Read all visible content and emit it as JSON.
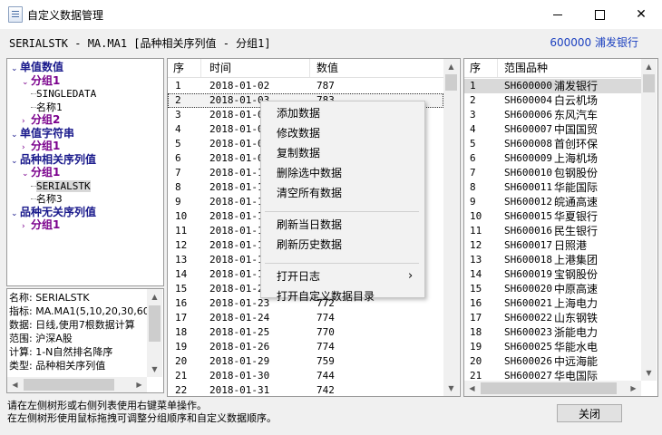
{
  "window": {
    "title": "自定义数据管理",
    "minimize": "—",
    "maximize": "☐",
    "close": "✕"
  },
  "infobar": {
    "serial_label": "SERIALSTK - MA.MA1 [品种相关序列值 - 分组1]",
    "stock": "600000 浦发银行",
    "stock_color": "#1a3fbf"
  },
  "tree": [
    {
      "label": "单值数值",
      "level": 0,
      "style": "blue",
      "expanded": true
    },
    {
      "label": "分组1",
      "level": 1,
      "style": "purple",
      "expanded": true
    },
    {
      "label": "SINGLEDATA",
      "level": 2,
      "style": "leaf"
    },
    {
      "label": "名称1",
      "level": 2,
      "style": "leaf"
    },
    {
      "label": "分组2",
      "level": 1,
      "style": "purple",
      "expanded": false
    },
    {
      "label": "单值字符串",
      "level": 0,
      "style": "blue",
      "expanded": true
    },
    {
      "label": "分组1",
      "level": 1,
      "style": "purple",
      "expanded": false
    },
    {
      "label": "品种相关序列值",
      "level": 0,
      "style": "blue",
      "expanded": true
    },
    {
      "label": "分组1",
      "level": 1,
      "style": "purple",
      "expanded": true
    },
    {
      "label": "SERIALSTK",
      "level": 2,
      "style": "leaf",
      "selected": true
    },
    {
      "label": "名称3",
      "level": 2,
      "style": "leaf"
    },
    {
      "label": "品种无关序列值",
      "level": 0,
      "style": "blue",
      "expanded": true
    },
    {
      "label": "分组1",
      "level": 1,
      "style": "purple",
      "expanded": false
    }
  ],
  "info": [
    "名称: SERIALSTK",
    "指标: MA.MA1(5,10,20,30,60",
    "数据: 日线,使用7根数据计算",
    "范围: 沪深A股",
    "计算: 1-N自然排名降序",
    "类型: 品种相关序列值"
  ],
  "data_table": {
    "headers": [
      "序",
      "时间",
      "数值"
    ],
    "rows": [
      [
        "1",
        "2018-01-02",
        "787"
      ],
      [
        "2",
        "2018-01-03",
        "783"
      ],
      [
        "3",
        "2018-01-04",
        ""
      ],
      [
        "4",
        "2018-01-05",
        ""
      ],
      [
        "5",
        "2018-01-08",
        ""
      ],
      [
        "6",
        "2018-01-09",
        ""
      ],
      [
        "7",
        "2018-01-10",
        ""
      ],
      [
        "8",
        "2018-01-11",
        ""
      ],
      [
        "9",
        "2018-01-12",
        ""
      ],
      [
        "10",
        "2018-01-15",
        ""
      ],
      [
        "11",
        "2018-01-16",
        ""
      ],
      [
        "12",
        "2018-01-17",
        ""
      ],
      [
        "13",
        "2018-01-18",
        ""
      ],
      [
        "14",
        "2018-01-19",
        ""
      ],
      [
        "15",
        "2018-01-22",
        ""
      ],
      [
        "16",
        "2018-01-23",
        "772"
      ],
      [
        "17",
        "2018-01-24",
        "774"
      ],
      [
        "18",
        "2018-01-25",
        "770"
      ],
      [
        "19",
        "2018-01-26",
        "774"
      ],
      [
        "20",
        "2018-01-29",
        "759"
      ],
      [
        "21",
        "2018-01-30",
        "744"
      ],
      [
        "22",
        "2018-01-31",
        "742"
      ]
    ],
    "visible_date_prefix": "2018-01"
  },
  "range_table": {
    "headers": [
      "序",
      "范围品种"
    ],
    "rows": [
      [
        "1",
        "SH600000",
        "浦发银行"
      ],
      [
        "2",
        "SH600004",
        "白云机场"
      ],
      [
        "3",
        "SH600006",
        "东风汽车"
      ],
      [
        "4",
        "SH600007",
        "中国国贸"
      ],
      [
        "5",
        "SH600008",
        "首创环保"
      ],
      [
        "6",
        "SH600009",
        "上海机场"
      ],
      [
        "7",
        "SH600010",
        "包钢股份"
      ],
      [
        "8",
        "SH600011",
        "华能国际"
      ],
      [
        "9",
        "SH600012",
        "皖通高速"
      ],
      [
        "10",
        "SH600015",
        "华夏银行"
      ],
      [
        "11",
        "SH600016",
        "民生银行"
      ],
      [
        "12",
        "SH600017",
        "日照港"
      ],
      [
        "13",
        "SH600018",
        "上港集团"
      ],
      [
        "14",
        "SH600019",
        "宝钢股份"
      ],
      [
        "15",
        "SH600020",
        "中原高速"
      ],
      [
        "16",
        "SH600021",
        "上海电力"
      ],
      [
        "17",
        "SH600022",
        "山东钢铁"
      ],
      [
        "18",
        "SH600023",
        "浙能电力"
      ],
      [
        "19",
        "SH600025",
        "华能水电"
      ],
      [
        "20",
        "SH600026",
        "中远海能"
      ],
      [
        "21",
        "SH600027",
        "华电国际"
      ]
    ]
  },
  "context_menu": {
    "items": [
      {
        "label": "添加数据"
      },
      {
        "label": "修改数据"
      },
      {
        "label": "复制数据"
      },
      {
        "label": "删除选中数据"
      },
      {
        "label": "清空所有数据"
      },
      {
        "separator": true
      },
      {
        "label": "刷新当日数据"
      },
      {
        "label": "刷新历史数据"
      },
      {
        "separator": true
      },
      {
        "label": "打开日志",
        "submenu": true
      },
      {
        "label": "打开自定义数据目录"
      }
    ],
    "submenu_arrow": "›"
  },
  "status": {
    "line1": "请在左侧树形或右侧列表使用右键菜单操作。",
    "line2": "在左侧树形使用鼠标拖拽可调整分组顺序和自定义数据顺序。"
  },
  "close_button": "关闭",
  "arrows": {
    "up": "▲",
    "down": "▼",
    "left": "◀",
    "right": "▶",
    "expanded": "⌄",
    "collapsed": "›"
  }
}
